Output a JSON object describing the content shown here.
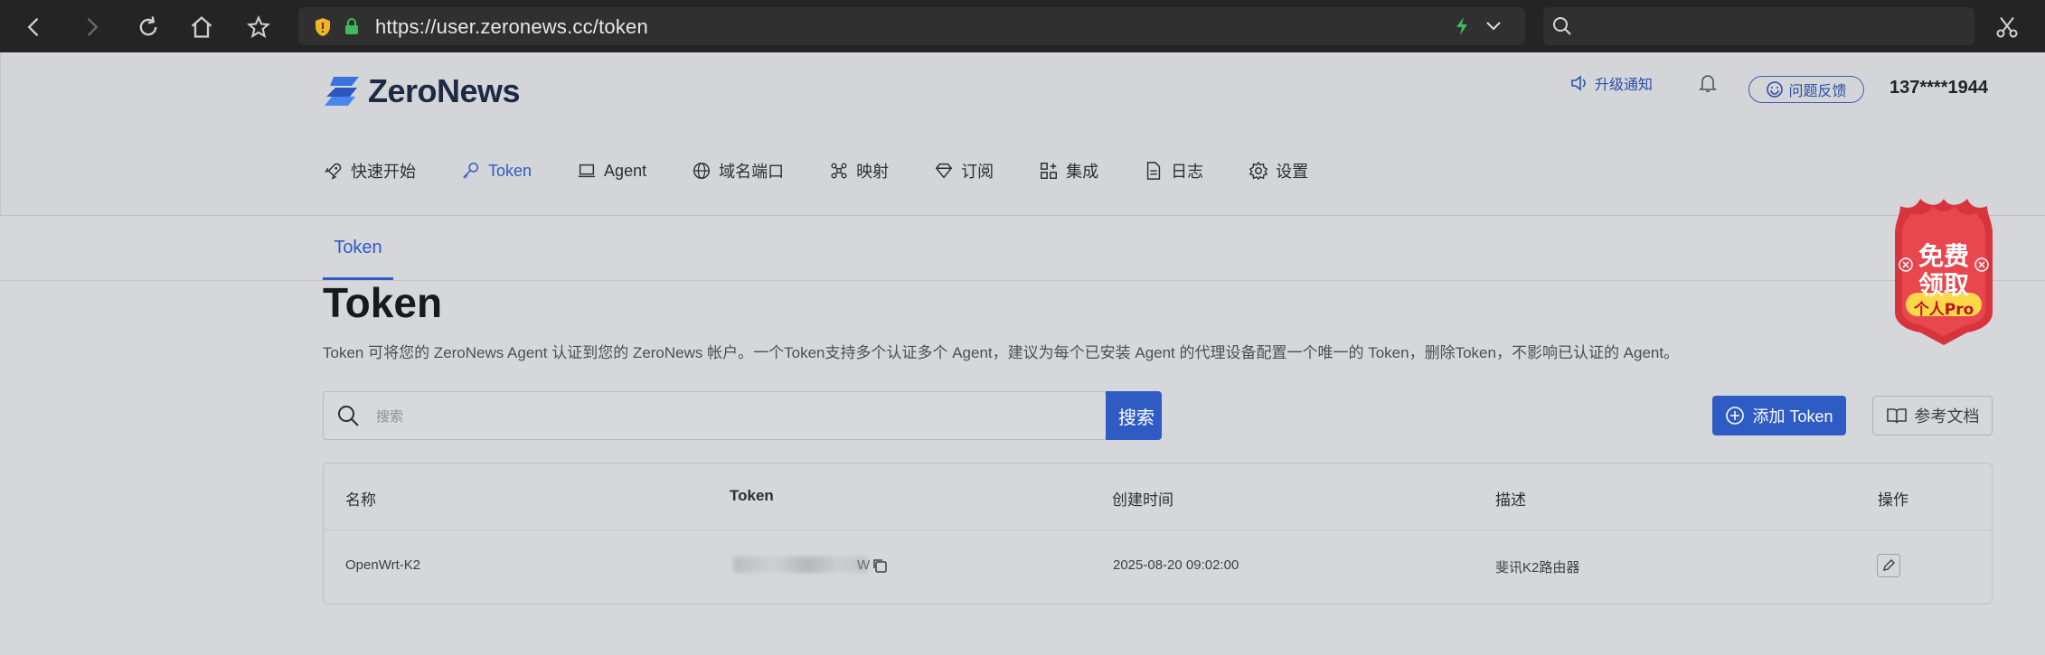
{
  "browser": {
    "url": "https://user.zeronews.cc/token",
    "search_placeholder": ""
  },
  "header": {
    "logo_text": "ZeroNews",
    "notice_label": "升级通知",
    "feedback_label": "问题反馈",
    "user": "137****1944"
  },
  "nav": {
    "items": [
      {
        "label": "快速开始",
        "icon": "rocket-icon"
      },
      {
        "label": "Token",
        "icon": "key-icon",
        "active": true
      },
      {
        "label": "Agent",
        "icon": "laptop-icon"
      },
      {
        "label": "域名端口",
        "icon": "globe-icon"
      },
      {
        "label": "映射",
        "icon": "mapping-icon"
      },
      {
        "label": "订阅",
        "icon": "diamond-icon"
      },
      {
        "label": "集成",
        "icon": "apps-icon"
      },
      {
        "label": "日志",
        "icon": "file-icon"
      },
      {
        "label": "设置",
        "icon": "gear-icon"
      }
    ]
  },
  "subtabs": {
    "active": "Token"
  },
  "page": {
    "title": "Token",
    "description": "Token 可将您的 ZeroNews Agent 认证到您的 ZeroNews 帐户。一个Token支持多个认证多个 Agent，建议为每个已安装 Agent 的代理设备配置一个唯一的 Token，删除Token，不影响已认证的 Agent。"
  },
  "toolbar": {
    "search_placeholder": "搜索",
    "search_button": "搜索",
    "add_button": "添加 Token",
    "docs_button": "参考文档"
  },
  "table": {
    "columns": [
      "名称",
      "Token",
      "创建时间",
      "描述",
      "操作"
    ],
    "rows": [
      {
        "name": "OpenWrt-K2",
        "token_visible": "W",
        "created": "2025-08-20 09:02:00",
        "desc": "斐讯K2路由器"
      }
    ]
  },
  "promo": {
    "line1": "免费",
    "line2": "领取",
    "tag": "个人Pro"
  },
  "colors": {
    "accent": "#2e5bc4",
    "promo_red": "#d8343c"
  }
}
